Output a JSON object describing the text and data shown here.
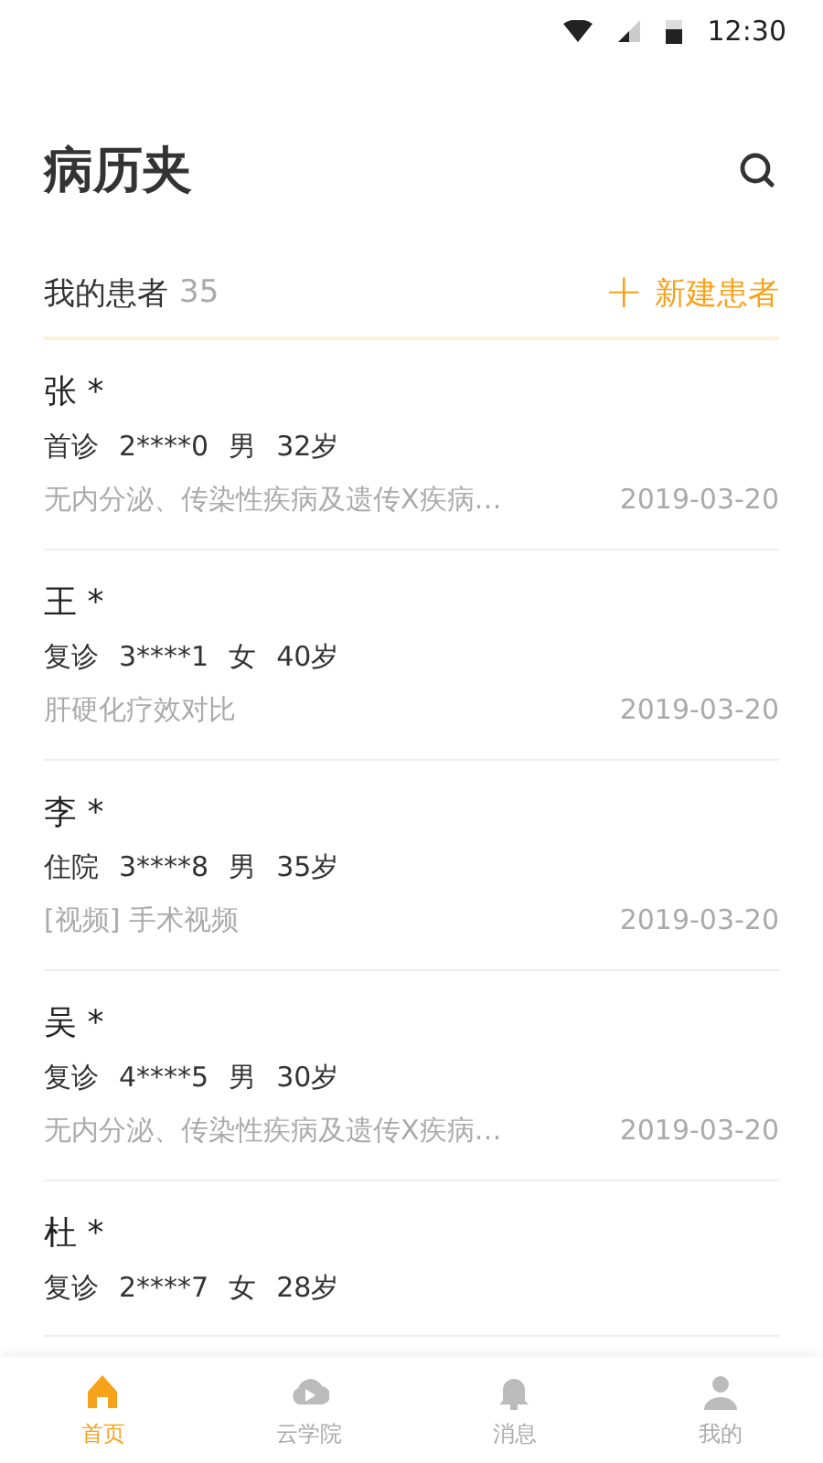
{
  "status_bar": {
    "time": "12:30"
  },
  "header": {
    "title": "病历夹"
  },
  "section": {
    "title": "我的患者",
    "count": "35",
    "action": {
      "icon": "+",
      "label": "新建患者"
    }
  },
  "patients": [
    {
      "name": "张 *",
      "visit": "首诊",
      "id": "2****0",
      "sex": "男",
      "age": "32岁",
      "note": "无内分泌、传染性疾病及遗传X疾病…",
      "date": "2019-03-20"
    },
    {
      "name": "王 *",
      "visit": "复诊",
      "id": "3****1",
      "sex": "女",
      "age": "40岁",
      "note": "肝硬化疗效对比",
      "date": "2019-03-20"
    },
    {
      "name": "李 *",
      "visit": "住院",
      "id": "3****8",
      "sex": "男",
      "age": "35岁",
      "note": "[视频] 手术视频",
      "date": "2019-03-20"
    },
    {
      "name": "吴 *",
      "visit": "复诊",
      "id": "4****5",
      "sex": "男",
      "age": "30岁",
      "note": "无内分泌、传染性疾病及遗传X疾病…",
      "date": "2019-03-20"
    },
    {
      "name": "杜 *",
      "visit": "复诊",
      "id": "2****7",
      "sex": "女",
      "age": "28岁"
    }
  ],
  "bottom_nav": [
    {
      "label": "首页",
      "kind": "home",
      "selected": true
    },
    {
      "label": "云学院",
      "kind": "cloud",
      "selected": false
    },
    {
      "label": "消息",
      "kind": "bell",
      "selected": false
    },
    {
      "label": "我的",
      "kind": "person",
      "selected": false
    }
  ]
}
